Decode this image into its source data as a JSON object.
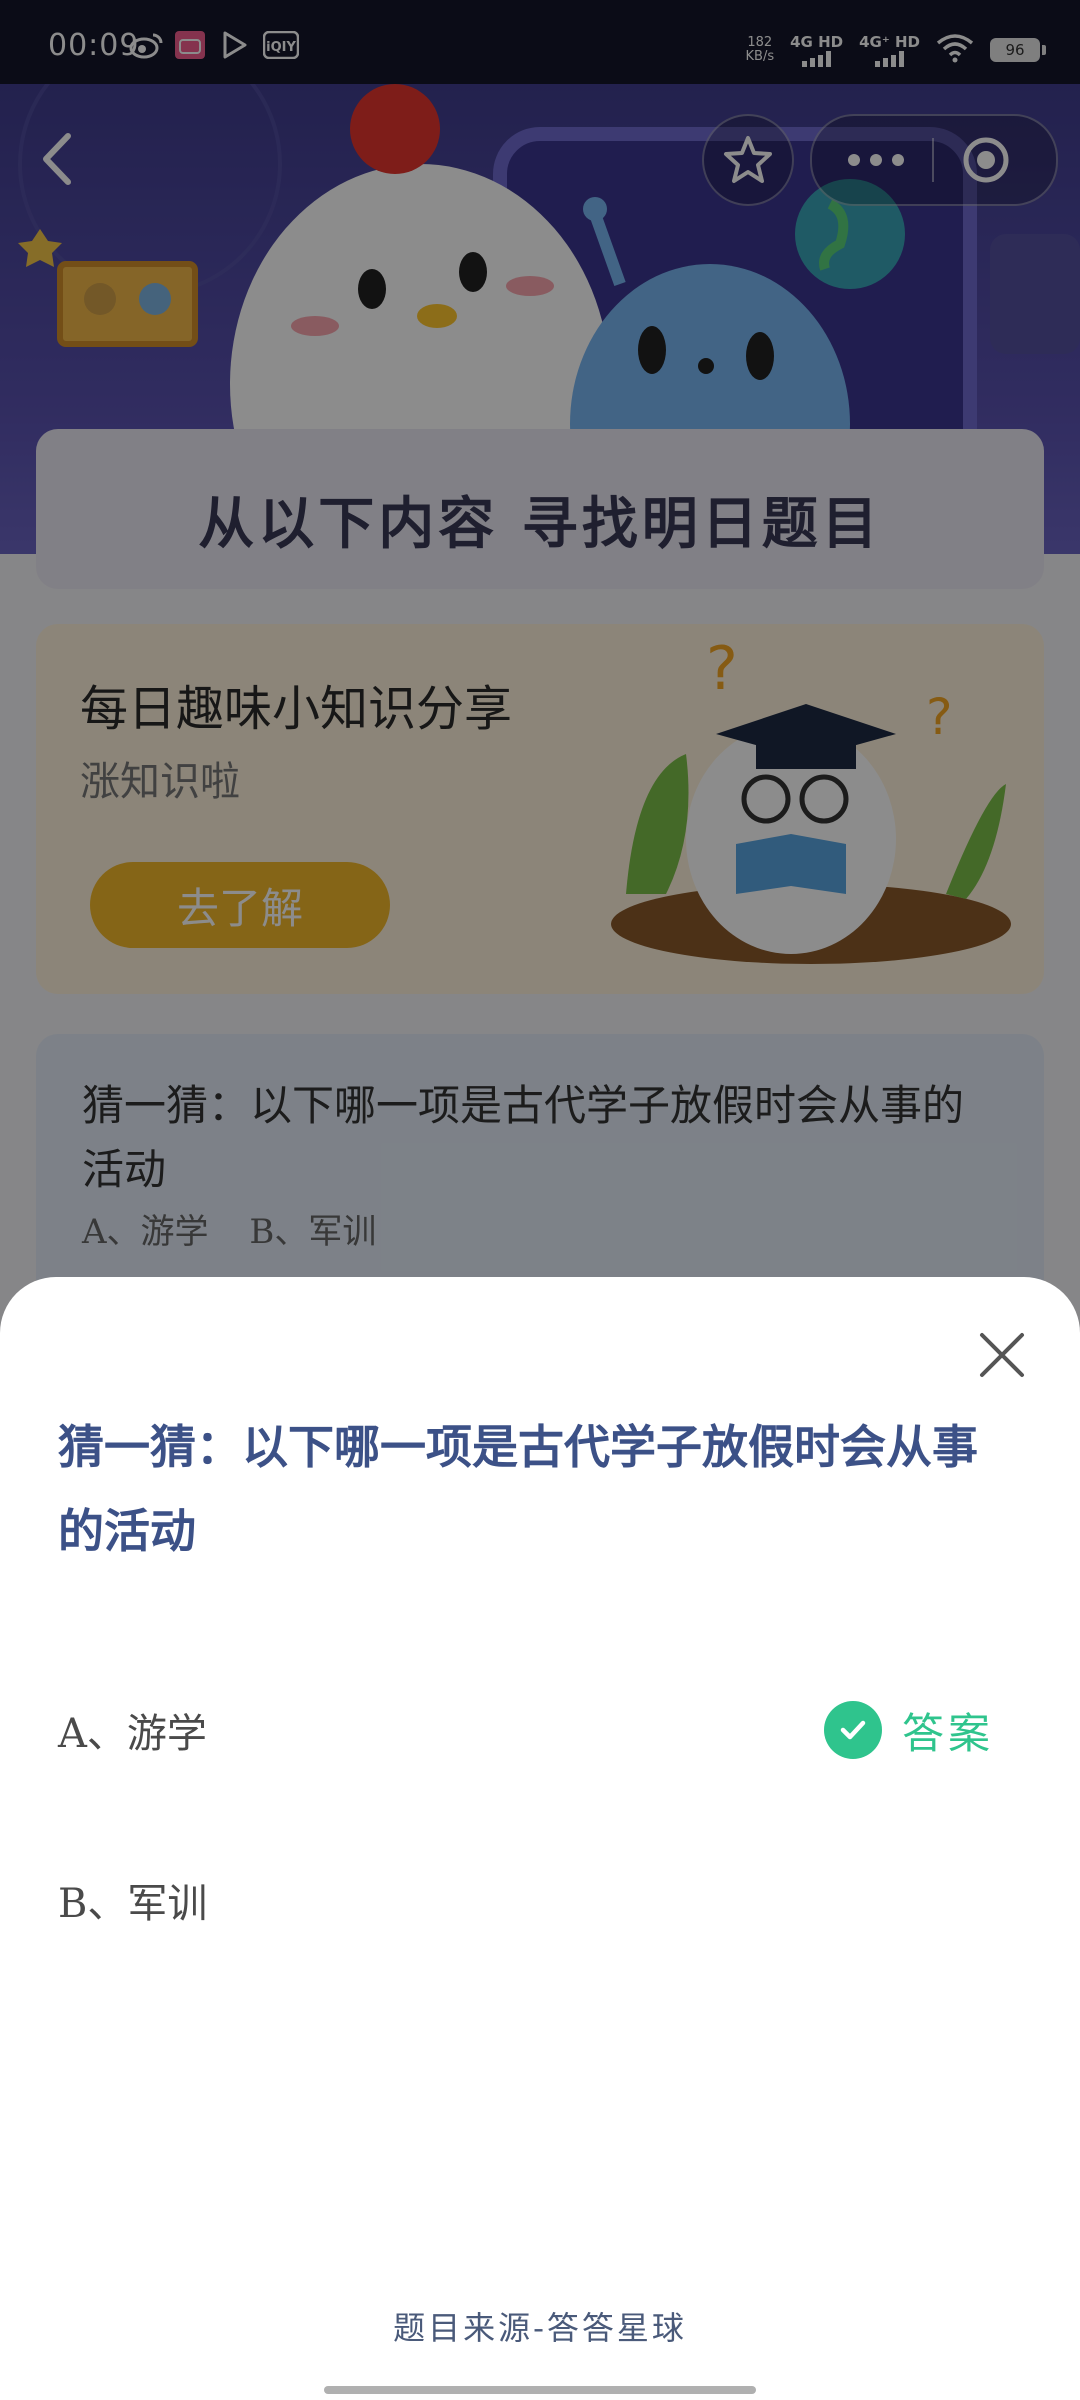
{
  "status_bar": {
    "time": "00:09",
    "net_speed_value": "182",
    "net_speed_unit": "KB/s",
    "sim1": "4G HD",
    "sim2": "4G⁺ HD",
    "battery": "96",
    "app_icons": [
      "weibo-icon",
      "bilibili-icon",
      "video-play-icon",
      "iqiyi-icon"
    ]
  },
  "header": {
    "back_icon": "chevron-left-icon",
    "favorite_icon": "star-icon",
    "more_icon": "more-dots-icon",
    "close_miniapp_icon": "target-icon"
  },
  "page": {
    "section_title": "从以下内容 寻找明日题目",
    "knowledge_card": {
      "title": "每日趣味小知识分享",
      "subtitle": "涨知识啦",
      "button_label": "去了解"
    },
    "question_card": {
      "question": "猜一猜：以下哪一项是古代学子放假时会从事的活动",
      "options_preview": "A、游学 B、军训"
    }
  },
  "sheet": {
    "question": "猜一猜：以下哪一项是古代学子放假时会从事的活动",
    "options": [
      {
        "label": "A、游学",
        "is_answer": true
      },
      {
        "label": "B、军训",
        "is_answer": false
      }
    ],
    "answer_label": "答案",
    "source": "题目来源-答答星球"
  },
  "colors": {
    "accent_green": "#2fc48d",
    "question_blue": "#3c5187",
    "hero_purple": "#5a52b0",
    "button_yellow": "#f3b82b"
  }
}
